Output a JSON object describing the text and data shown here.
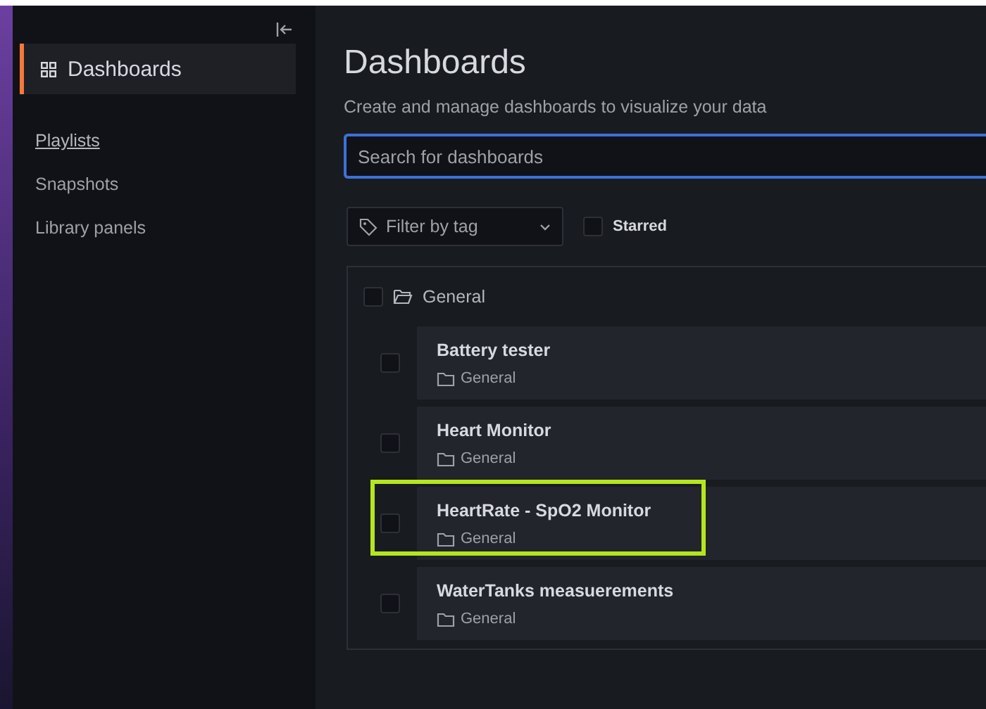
{
  "sidebar": {
    "active": {
      "label": "Dashboards",
      "selected": true
    },
    "items": [
      {
        "label": "Playlists",
        "hovered": true
      },
      {
        "label": "Snapshots",
        "hovered": false
      },
      {
        "label": "Library panels",
        "hovered": false
      }
    ]
  },
  "page": {
    "title": "Dashboards",
    "subtitle": "Create and manage dashboards to visualize your data"
  },
  "search": {
    "placeholder": "Search for dashboards"
  },
  "filter": {
    "placeholder": "Filter by tag"
  },
  "starred": {
    "label": "Starred",
    "checked": false
  },
  "folder": {
    "name": "General",
    "checked": false
  },
  "dashboards": [
    {
      "title": "Battery tester",
      "folder": "General",
      "checked": false,
      "highlighted": false
    },
    {
      "title": "Heart Monitor",
      "folder": "General",
      "checked": false,
      "highlighted": false
    },
    {
      "title": "HeartRate - SpO2 Monitor",
      "folder": "General",
      "checked": false,
      "highlighted": true
    },
    {
      "title": "WaterTanks measuerements",
      "folder": "General",
      "checked": false,
      "highlighted": false
    }
  ]
}
